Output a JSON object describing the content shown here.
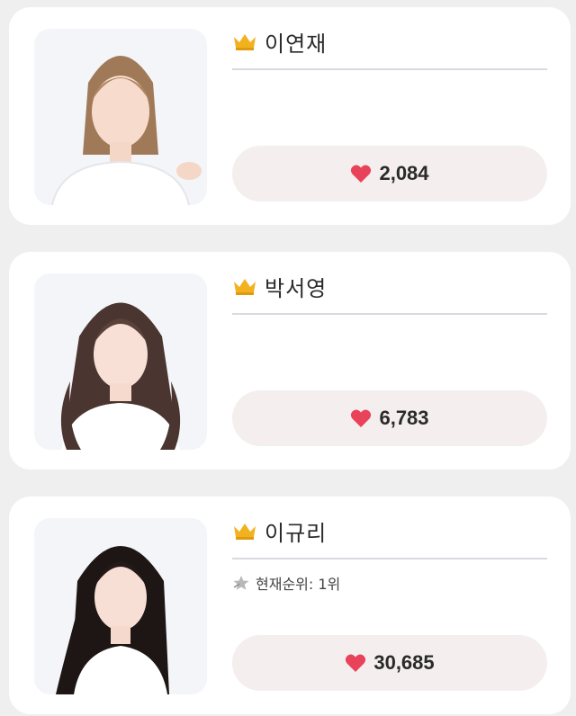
{
  "candidates": [
    {
      "name": "이연재",
      "votes": "2,084"
    },
    {
      "name": "박서영",
      "votes": "6,783"
    },
    {
      "name": "이규리",
      "votes": "30,685",
      "rank_text": "현재순위: 1위"
    }
  ],
  "colors": {
    "crown": "#f2b21f",
    "heart": "#e8435a",
    "vote_button_bg": "#f4efee",
    "card_bg": "#ffffff",
    "page_bg": "#efefef"
  },
  "icons": {
    "crown": "crown-icon",
    "heart": "heart-icon",
    "rank": "star-icon"
  }
}
